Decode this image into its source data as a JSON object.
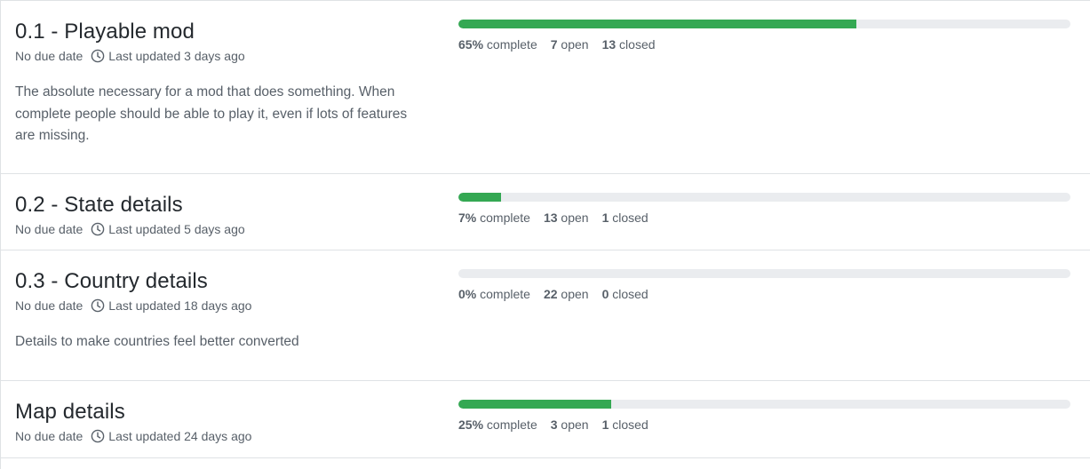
{
  "milestones": [
    {
      "title": "0.1 - Playable mod",
      "due": "No due date",
      "updated": "Last updated 3 days ago",
      "description": "The absolute necessary for a mod that does something. When complete people should be able to play it, even if lots of features are missing.",
      "progress": 0.65,
      "percent": "65%",
      "percent_label": "complete",
      "open_count": "7",
      "open_label": "open",
      "closed_count": "13",
      "closed_label": "closed"
    },
    {
      "title": "0.2 - State details",
      "due": "No due date",
      "updated": "Last updated 5 days ago",
      "description": "",
      "progress": 0.07,
      "percent": "7%",
      "percent_label": "complete",
      "open_count": "13",
      "open_label": "open",
      "closed_count": "1",
      "closed_label": "closed"
    },
    {
      "title": "0.3 - Country details",
      "due": "No due date",
      "updated": "Last updated 18 days ago",
      "description": "Details to make countries feel better converted",
      "progress": 0.0,
      "percent": "0%",
      "percent_label": "complete",
      "open_count": "22",
      "open_label": "open",
      "closed_count": "0",
      "closed_label": "closed"
    },
    {
      "title": "Map details",
      "due": "No due date",
      "updated": "Last updated 24 days ago",
      "description": "",
      "progress": 0.25,
      "percent": "25%",
      "percent_label": "complete",
      "open_count": "3",
      "open_label": "open",
      "closed_count": "1",
      "closed_label": "closed"
    }
  ],
  "colors": {
    "progress_fill": "#34a853",
    "progress_track": "#eaecef",
    "border": "#dfe2e5",
    "muted_text": "#586069"
  },
  "icons": {
    "updated": "clock-icon"
  }
}
